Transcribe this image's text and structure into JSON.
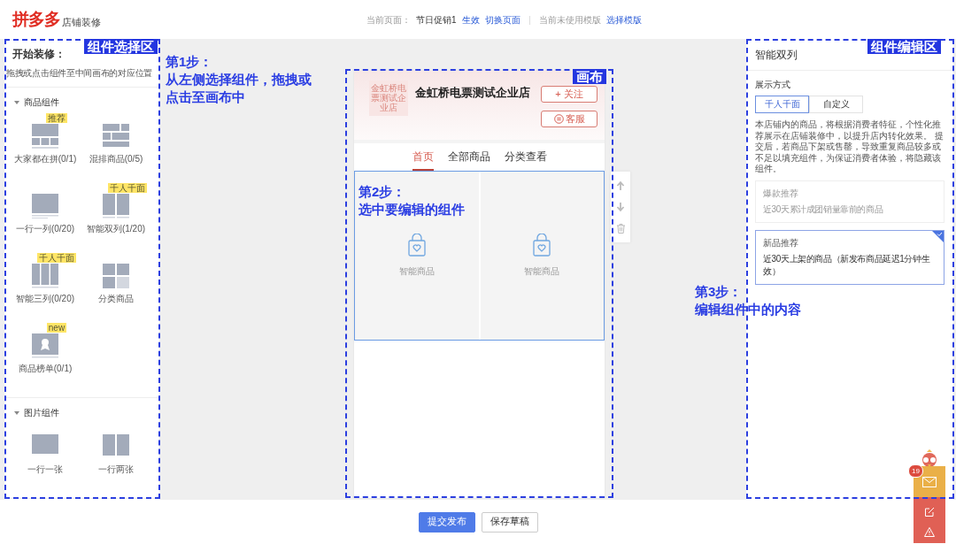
{
  "header": {
    "logo": "拼多多",
    "subtitle": "店铺装修",
    "current_page_label": "当前页面：",
    "current_page": "节日促销1",
    "status": "生效",
    "switch_link": "切换页面",
    "template_label": "当前未使用模版",
    "template_link": "选择模版"
  },
  "left_panel": {
    "title": "开始装修：",
    "hint": "拖拽或点击组件至中间画布的对应位置",
    "sections": [
      {
        "title": "商品组件",
        "expanded": true,
        "items": [
          {
            "label": "大家都在拼(0/1)",
            "badge": "推荐",
            "kind": "mosaic"
          },
          {
            "label": "混排商品(0/5)",
            "kind": "mixed"
          },
          {
            "label": "一行一列(0/20)",
            "kind": "single"
          },
          {
            "label": "智能双列(1/20)",
            "badge": "千人千面",
            "kind": "double"
          },
          {
            "label": "智能三列(0/20)",
            "badge": "千人千面",
            "kind": "triple"
          },
          {
            "label": "分类商品",
            "kind": "category"
          },
          {
            "label": "商品榜单(0/1)",
            "badge": "new",
            "kind": "ranking"
          }
        ]
      },
      {
        "title": "图片组件",
        "expanded": true,
        "items": [
          {
            "label": "一行一张",
            "kind": "image-single"
          },
          {
            "label": "一行两张",
            "kind": "image-double"
          }
        ]
      }
    ]
  },
  "canvas": {
    "shop_logo_text": "金虹桥电票测试企业店",
    "shop_name": "金虹桥电票测试企业店",
    "follow_button": "+ 关注",
    "service_button": "客服",
    "tabs": [
      {
        "label": "首页",
        "selected": true
      },
      {
        "label": "全部商品",
        "selected": false
      },
      {
        "label": "分类查看",
        "selected": false
      }
    ],
    "component": {
      "selected": true,
      "cells": [
        "智能商品",
        "智能商品"
      ]
    }
  },
  "edit_panel": {
    "title": "智能双列",
    "display_label": "展示方式",
    "mode_tabs": [
      {
        "label": "千人千面",
        "selected": true
      },
      {
        "label": "自定义",
        "selected": false
      }
    ],
    "description": "本店铺内的商品，将根据消费者特征，个性化推荐展示在店铺装修中，以提升店内转化效果。 提交后，若商品下架或售罄，导致重复商品较多或不足以填充组件，为保证消费者体验，将隐藏该组件。",
    "options": [
      {
        "title": "爆款推荐",
        "subtitle": "近30天累计成团销量靠前的商品",
        "selected": false
      },
      {
        "title": "新品推荐",
        "subtitle": "近30天上架的商品（新发布商品延迟1分钟生效）",
        "selected": true
      }
    ]
  },
  "footer": {
    "buttons": [
      {
        "label": "提交发布",
        "kind": "primary"
      },
      {
        "label": "保存草稿",
        "kind": "default"
      }
    ]
  },
  "float_bar": {
    "badge": "19"
  },
  "guide": {
    "zones": [
      {
        "label": "组件选择区"
      },
      {
        "label": "画布"
      },
      {
        "label": "组件编辑区"
      }
    ],
    "steps": [
      {
        "title": "第1步：",
        "text": "从左侧选择组件，拖拽或点击至画布中"
      },
      {
        "title": "第2步：",
        "text": "选中要编辑的组件"
      },
      {
        "title": "第3步：",
        "text": "编辑组件中的内容"
      }
    ]
  }
}
